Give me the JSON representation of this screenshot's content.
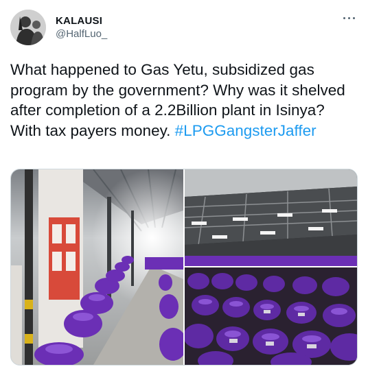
{
  "author": {
    "name": "KALAUSI",
    "handle": "@HalfLuo_"
  },
  "tweet": {
    "text": "What happened to Gas Yetu, subsidized gas program by the government? Why was it shelved after completion of a 2.2Billion plant in Isinya? With tax payers money. ",
    "hashtag": "#LPGGangsterJaffer"
  },
  "icons": {
    "more": "more-dots-icon"
  },
  "colors": {
    "link": "#1d9bf0",
    "text": "#0f1419",
    "secondary": "#536471",
    "cylinder": "#6b2fb5"
  }
}
